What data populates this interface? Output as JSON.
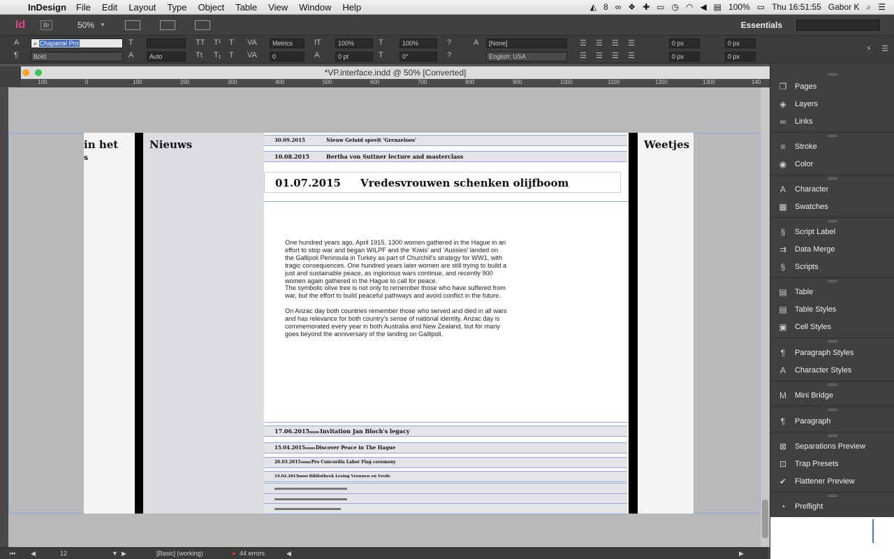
{
  "menubar": {
    "app": "InDesign",
    "items": [
      "File",
      "Edit",
      "Layout",
      "Type",
      "Object",
      "Table",
      "View",
      "Window",
      "Help"
    ],
    "status": {
      "badge": "8",
      "battery": "100%",
      "clock": "Thu 16:51:55",
      "user": "Gabor K"
    }
  },
  "appbar": {
    "logo": "Id",
    "bridge": "Br",
    "zoom": "50%",
    "workspace": "Essentials"
  },
  "control": {
    "font": "Chaparral Pro",
    "style": "Bold",
    "leading": "Auto",
    "kerning": "Metrics",
    "tracking": "0",
    "vscale": "100%",
    "hscale": "100%",
    "baseline": "0 pt",
    "skew": "0°",
    "char_style": "[None]",
    "language": "English: USA",
    "indent1": "0 px",
    "indent2": "0 px",
    "indent3": "0 px",
    "indent4": "0 px"
  },
  "document": {
    "title": "*VP.interface.indd @ 50% [Converted]",
    "ruler": [
      "100",
      "0",
      "100",
      "200",
      "300",
      "400",
      "500",
      "600",
      "700",
      "800",
      "900",
      "1000",
      "1100",
      "1200",
      "1300",
      "140"
    ]
  },
  "page": {
    "left_heading": "in het",
    "left_heading2": "s",
    "nieuws": "Nieuws",
    "weetjes": "Weetjes",
    "top_rows": [
      {
        "date": "30.09.2015",
        "title": "Nieuw Geluid speelt 'Grenzeloos'"
      },
      {
        "date": "10.08.2015",
        "title": "Bertha von Suttner lecture and masterclass"
      }
    ],
    "feature": {
      "date": "01.07.2015",
      "title": "Vredesvrouwen schenken olijfboom"
    },
    "body": [
      "One hundred years ago, April 1915, 1300 women gathered in the Hague in an effort to stop war and began WILPF and the ‘Kiwis’ and ‘Aussies’ landed on the Gallipoli Peninsula in Turkey as part of Churchill's strategy for WW1, with tragic consequences. One hundred years later women are still trying to build a just and sustainable peace, as inglorious wars continue, and recently 900 women again gathered in the Hague to call for peace.",
      "The symbolic olive tree is not only to remember those who have suffered from war, but the effort to build peaceful pathways and avoid conflict in the future.",
      "On Anzac day both countries remember those who served and died in all wars and has relevance for both country's sense of national identity. Anzac day is commemorated every year in both Australia and New Zealand, but for many goes beyond the anniversary of the landing on Gallipoli."
    ],
    "bottom_rows": [
      {
        "date": "17.06.2015",
        "title": "Invitation Jan Bloch's legacy"
      },
      {
        "date": "15.04.2015",
        "title": "Discover Peace in The Hague"
      },
      {
        "date": "26.03.2015",
        "title": "Pro Concordia Labor Flag ceremony"
      },
      {
        "date": "19.02.2015",
        "title": "Bibliotheek Lezing Vrouwen en Vrede"
      }
    ]
  },
  "statusbar": {
    "page": "12",
    "style": "[Basic] (working)",
    "errors": "44 errors"
  },
  "panel": [
    {
      "label": "Pages",
      "icon": "pages-icon",
      "glyph": "❐"
    },
    {
      "label": "Layers",
      "icon": "layers-icon",
      "glyph": "◈"
    },
    {
      "label": "Links",
      "icon": "links-icon",
      "glyph": "∞"
    },
    {
      "label": "Stroke",
      "icon": "stroke-icon",
      "glyph": "≡"
    },
    {
      "label": "Color",
      "icon": "color-icon",
      "glyph": "◉"
    },
    {
      "label": "Character",
      "icon": "character-icon",
      "glyph": "A"
    },
    {
      "label": "Swatches",
      "icon": "swatches-icon",
      "glyph": "▦"
    },
    {
      "label": "Script Label",
      "icon": "script-label-icon",
      "glyph": "§"
    },
    {
      "label": "Data Merge",
      "icon": "data-merge-icon",
      "glyph": "⇉"
    },
    {
      "label": "Scripts",
      "icon": "scripts-icon",
      "glyph": "§"
    },
    {
      "label": "Table",
      "icon": "table-icon",
      "glyph": "▤"
    },
    {
      "label": "Table Styles",
      "icon": "table-styles-icon",
      "glyph": "▤"
    },
    {
      "label": "Cell Styles",
      "icon": "cell-styles-icon",
      "glyph": "▣"
    },
    {
      "label": "Paragraph Styles",
      "icon": "paragraph-styles-icon",
      "glyph": "¶"
    },
    {
      "label": "Character Styles",
      "icon": "character-styles-icon",
      "glyph": "A"
    },
    {
      "label": "Mini Bridge",
      "icon": "mini-bridge-icon",
      "glyph": "M"
    },
    {
      "label": "Paragraph",
      "icon": "paragraph-icon",
      "glyph": "¶"
    },
    {
      "label": "Separations Preview",
      "icon": "separations-icon",
      "glyph": "⊠"
    },
    {
      "label": "Trap Presets",
      "icon": "trap-presets-icon",
      "glyph": "⊡"
    },
    {
      "label": "Flattener Preview",
      "icon": "flattener-icon",
      "glyph": "✔"
    },
    {
      "label": "Preflight",
      "icon": "preflight-icon",
      "glyph": "◔"
    }
  ]
}
